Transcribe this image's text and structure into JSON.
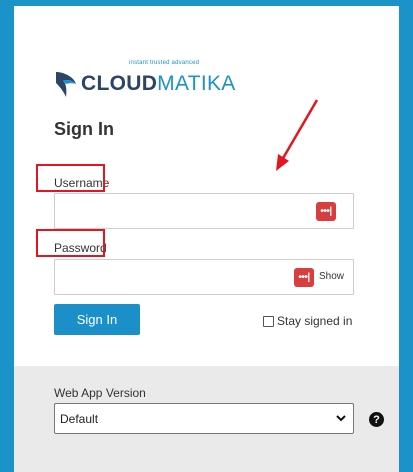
{
  "brand": {
    "tagline": "instant trusted advanced",
    "name_part1": "CLOUD",
    "name_part2": "MATIKA"
  },
  "login": {
    "title": "Sign In",
    "username_label": "Username",
    "username_value": "",
    "username_icon": "password-manager-icon",
    "password_label": "Password",
    "password_value": "",
    "password_icon": "password-manager-icon",
    "show_label": "Show",
    "signin_button": "Sign In",
    "stay_signed_in_label": "Stay signed in",
    "stay_signed_in_checked": false
  },
  "footer": {
    "version_label": "Web App Version",
    "version_selected": "Default",
    "help_icon": "question-circle-icon"
  },
  "annotations": {
    "highlight_color": "#e3151e",
    "arrow_color": "#e3151e"
  },
  "colors": {
    "background": "#1b93c9",
    "accent": "#1a8fc8",
    "brand_dark": "#2b4566"
  }
}
